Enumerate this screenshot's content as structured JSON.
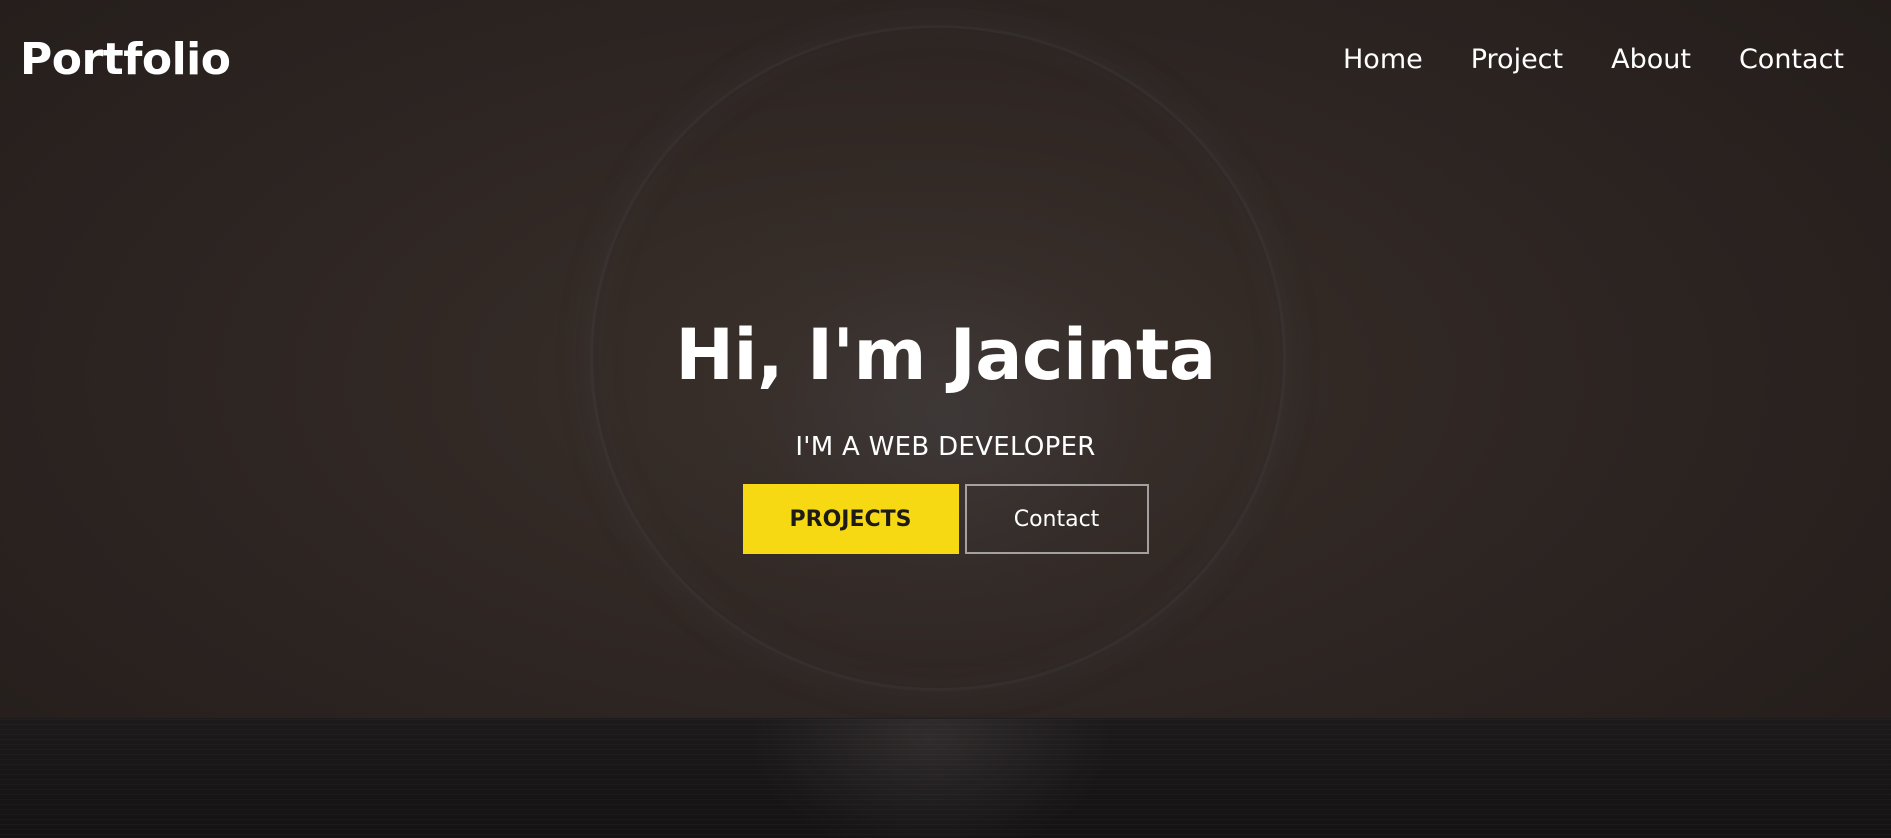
{
  "header": {
    "logo": "Portfolio",
    "nav": [
      {
        "label": "Home"
      },
      {
        "label": "Project"
      },
      {
        "label": "About"
      },
      {
        "label": "Contact"
      }
    ]
  },
  "hero": {
    "title": "Hi, I'm Jacinta",
    "subtitle": "I'M A WEB DEVELOPER",
    "primary_button": "PROJECTS",
    "secondary_button": "Contact"
  },
  "colors": {
    "accent": "#f6d913",
    "background": "#2c2421",
    "text": "#ffffff"
  }
}
